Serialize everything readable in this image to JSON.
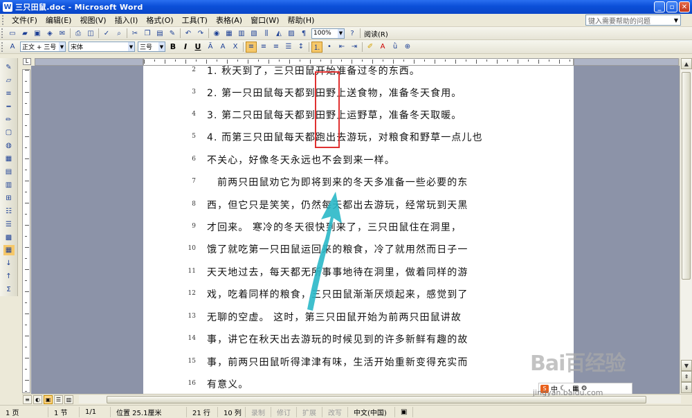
{
  "window": {
    "title": "三只田鼠.doc - Microsoft Word",
    "app_icon": "W"
  },
  "menu": [
    "文件(F)",
    "编辑(E)",
    "视图(V)",
    "插入(I)",
    "格式(O)",
    "工具(T)",
    "表格(A)",
    "窗口(W)",
    "帮助(H)"
  ],
  "help_search": {
    "placeholder": "键入需要帮助的问题"
  },
  "toolbar_standard": {
    "zoom": "100%",
    "read_label": "阅读(R)"
  },
  "toolbar_format": {
    "style": "正文 + 三号",
    "font": "宋体",
    "size": "三号",
    "bold": "B",
    "italic": "I",
    "underline": "U"
  },
  "document": {
    "lines": [
      {
        "num": "2",
        "text": "1. 秋天到了，三只田鼠开始准备过冬的东西。"
      },
      {
        "num": "3",
        "text": "2. 第一只田鼠每天都到田野上送食物，准备冬天食用。"
      },
      {
        "num": "4",
        "text": "3. 第二只田鼠每天都到田野上运野草，准备冬天取暖。"
      },
      {
        "num": "5",
        "text": "4. 而第三只田鼠每天都跑出去游玩，对粮食和野草一点儿也"
      },
      {
        "num": "6",
        "text": "不关心，好像冬天永远也不会到来一样。"
      },
      {
        "num": "7",
        "text": "前两只田鼠劝它为即将到来的冬天多准备一些必要的东"
      },
      {
        "num": "8",
        "text": "西，但它只是笑笑，仍然每天都出去游玩，经常玩到天黑"
      },
      {
        "num": "9",
        "text": "才回来。  寒冷的冬天很快到来了，三只田鼠住在洞里，"
      },
      {
        "num": "10",
        "text": "饿了就吃第一只田鼠运回来的粮食，冷了就用然而日子一"
      },
      {
        "num": "11",
        "text": "天天地过去，每天都无所事事地待在洞里，做着同样的游"
      },
      {
        "num": "12",
        "text": "戏，吃着同样的粮食，三只田鼠渐渐厌烦起来，感觉到了"
      },
      {
        "num": "13",
        "text": "无聊的空虚。  这时，第三只田鼠开始为前两只田鼠讲故"
      },
      {
        "num": "14",
        "text": "事，讲它在秋天出去游玩的时候见到的许多新鲜有趣的故"
      },
      {
        "num": "15",
        "text": "事，前两只田鼠听得津津有味，生活开始重新变得充实而"
      },
      {
        "num": "16",
        "text": "有意义。"
      }
    ]
  },
  "statusbar": {
    "page": "1 页",
    "section": "1 节",
    "pages": "1/1",
    "position": "位置 25.1厘米",
    "line": "21 行",
    "column": "10 列",
    "rec": "录制",
    "trk": "修订",
    "ext": "扩展",
    "ovr": "改写",
    "lang": "中文(中国)"
  },
  "watermark": {
    "logo": "Bai百经验",
    "url": "jingyan.baidu.com"
  },
  "ime": {
    "label": "中"
  }
}
